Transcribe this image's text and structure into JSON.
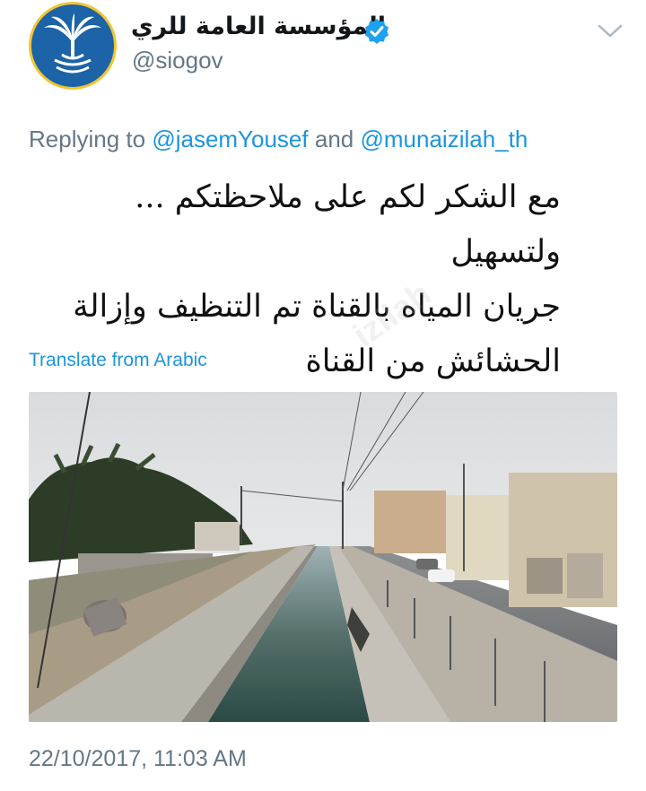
{
  "tweet": {
    "author": {
      "display_name": "المؤسسة العامة للري",
      "handle": "@siogov",
      "verified": true,
      "avatar_icon": "palm-tree-logo-icon"
    },
    "menu_icon": "chevron-down-icon",
    "reply": {
      "prefix": "Replying to",
      "mention_1": "@jasemYousef",
      "connector": "and",
      "mention_2": "@munaizilah_th"
    },
    "text_lines": [
      "مع الشكر لكم على ملاحظتكم ... ولتسهيل",
      "جريان المياه بالقناة تم التنظيف وإزالة",
      "الحشائش من القناة"
    ],
    "translate_label": "Translate from Arabic",
    "image_icon": "canal-photo",
    "timestamp": "22/10/2017, 11:03 AM",
    "watermark": "izilah"
  },
  "colors": {
    "link": "#1b95e0",
    "muted": "#657786",
    "avatar_bg": "#1c63a8",
    "avatar_ring": "#f2c531"
  }
}
